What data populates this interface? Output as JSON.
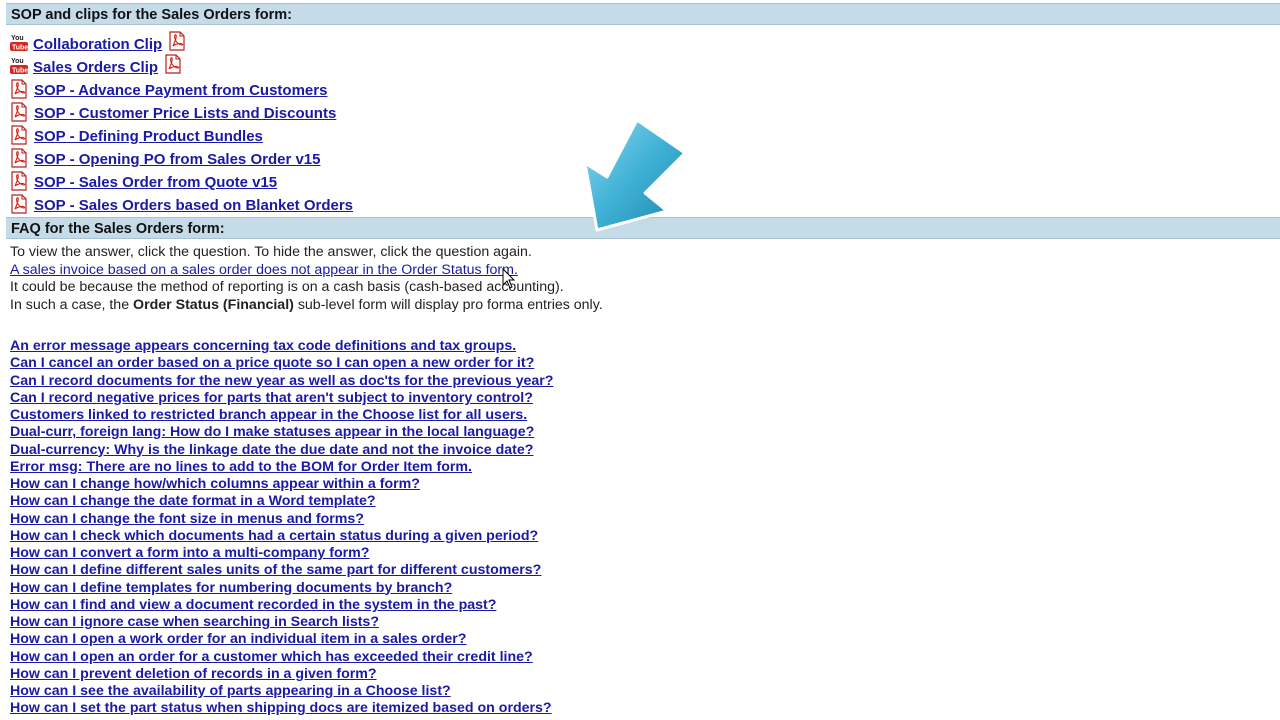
{
  "sop_section": {
    "title": "SOP and clips for the Sales Orders form:",
    "items": [
      {
        "label": "Collaboration Clip",
        "lead_icon": "youtube-icon",
        "trail_icon": "pdf-icon"
      },
      {
        "label": "Sales Orders Clip",
        "lead_icon": "youtube-icon",
        "trail_icon": "pdf-icon"
      },
      {
        "label": "SOP - Advance Payment from Customers",
        "lead_icon": "pdf-icon"
      },
      {
        "label": "SOP - Customer Price Lists and Discounts",
        "lead_icon": "pdf-icon"
      },
      {
        "label": "SOP - Defining Product Bundles",
        "lead_icon": "pdf-icon"
      },
      {
        "label": "SOP - Opening PO from Sales Order v15",
        "lead_icon": "pdf-icon"
      },
      {
        "label": "SOP - Sales Order from Quote v15",
        "lead_icon": "pdf-icon"
      },
      {
        "label": "SOP - Sales Orders based on Blanket Orders",
        "lead_icon": "pdf-icon"
      }
    ]
  },
  "faq_section": {
    "title": "FAQ for the Sales Orders form:",
    "instructions": "To view the answer, click the question. To hide the answer, click the question again.",
    "open_question": "A sales invoice based on a sales order does not appear in the Order Status form.",
    "answer_line1": "It could be because the method of reporting is on a cash basis (cash-based accounting).",
    "answer_line2_pre": "In such a case, the ",
    "answer_line2_bold": "Order Status (Financial)",
    "answer_line2_post": " sub-level form will display pro forma entries only.",
    "questions": [
      "An error message appears concerning tax code definitions and tax groups.",
      "Can I cancel an order based on a price quote so I can open a new order for it?",
      "Can I record documents for the new year as well as doc'ts for the previous year?",
      "Can I record negative prices for parts that aren't subject to inventory control?",
      "Customers linked to restricted branch appear in the Choose list for all users.",
      "Dual-curr, foreign lang: How do I make statuses appear in the local language?",
      "Dual-currency: Why is the linkage date the due date and not the invoice date?",
      "Error msg: There are no lines to add to the BOM for Order Item form.",
      "How can I change how/which columns appear within a form?",
      "How can I change the date format in a Word template?",
      "How can I change the font size in menus and forms?",
      "How can I check which documents had a certain status during a given period?",
      "How can I convert a form into a multi-company form?",
      "How can I define different sales units of the same part for different customers?",
      "How can I define templates for numbering documents by branch?",
      "How can I find and view a document recorded in the system in the past?",
      "How can I ignore case when searching in Search lists?",
      "How can I open a work order for an individual item in a sales order?",
      "How can I open an order for a customer which has exceeded their credit line?",
      "How can I prevent deletion of records in a given form?",
      "How can I see the availability of parts appearing in a Choose list?",
      "How can I set the part status when shipping docs are itemized based on orders?"
    ]
  },
  "colors": {
    "link": "#1a1aa6",
    "header_bg": "#c5dbe8",
    "arrow": "#3fb1d6"
  }
}
